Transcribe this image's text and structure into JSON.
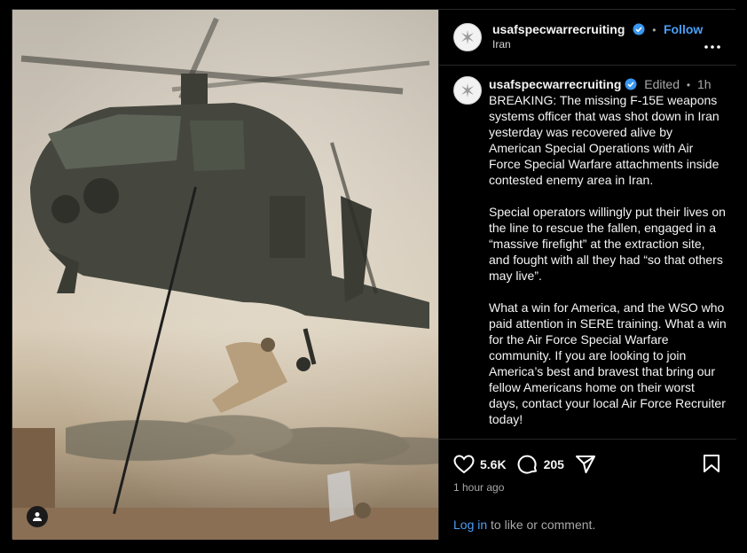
{
  "post": {
    "author": "usafspecwarrecruiting",
    "follow_label": "Follow",
    "location": "Iran",
    "separator": "•",
    "more_icon": "more-horizontal-icon",
    "edited_label": "Edited",
    "caption_time": "1h",
    "caption_paragraphs": [
      "BREAKING: The missing F-15E weapons systems officer that was shot down in Iran yesterday was recovered alive by American Special Operations with Air Force Special Warfare attachments inside contested enemy area in Iran.",
      "Special operators willingly put their lives on the line to rescue the fallen, engaged in a “massive firefight” at the extraction site, and fought with all they had “so that others may live”.",
      "What a win for America, and the WSO who paid attention in SERE training. What a win for the Air Force Special Warfare community. If you are looking to join America’s best and bravest that bring our fellow Americans home on their worst days, contact your local Air Force Recruiter today!"
    ],
    "likes": "5.6K",
    "comments": "205",
    "posted_ago": "1 hour ago",
    "login_link": "Log in",
    "login_suffix": " to like or comment."
  },
  "colors": {
    "accent": "#4a9ff7",
    "verified": "#3897f0",
    "muted": "#a8a8a8",
    "background": "#000000"
  },
  "icons": {
    "like": "heart-icon",
    "comment": "comment-icon",
    "share": "send-icon",
    "save": "bookmark-icon",
    "tagged": "user-icon"
  }
}
